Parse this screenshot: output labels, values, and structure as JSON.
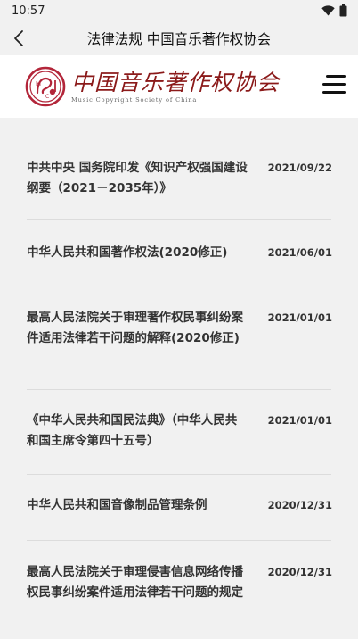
{
  "status_bar": {
    "time": "10:57"
  },
  "title_bar": {
    "title": "法律法规 中国音乐著作权协会"
  },
  "header": {
    "logo_cn": "中国音乐著作权协会",
    "logo_en": "Music Copyright Society of China"
  },
  "items": [
    {
      "title": "中共中央 国务院印发《知识产权强国建设纲要（2021－2035年）》",
      "date": "2021/09/22"
    },
    {
      "title": "中华人民共和国著作权法(2020修正)",
      "date": "2021/06/01"
    },
    {
      "title": "最高人民法院关于审理著作权民事纠纷案件适用法律若干问题的解释(2020修正)",
      "date": "2021/01/01"
    },
    {
      "title": "《中华人民共和国民法典》（中华人民共和国主席令第四十五号）",
      "date": "2021/01/01"
    },
    {
      "title": "中华人民共和国音像制品管理条例",
      "date": "2020/12/31"
    },
    {
      "title": "最高人民法院关于审理侵害信息网络传播权民事纠纷案件适用法律若干问题的规定",
      "date": "2020/12/31"
    }
  ],
  "colors": {
    "brand": "#b3263a",
    "background": "#f1f1f1"
  }
}
